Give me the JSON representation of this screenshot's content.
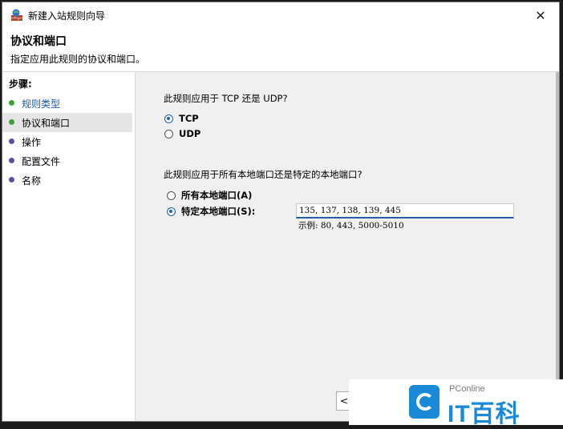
{
  "window": {
    "title": "新建入站规则向导",
    "close_glyph": "✕"
  },
  "header": {
    "title": "协议和端口",
    "subtitle": "指定应用此规则的协议和端口。"
  },
  "sidebar": {
    "steps_title": "步骤:",
    "items": [
      {
        "label": "规则类型",
        "dot_color": "#3aa23a"
      },
      {
        "label": "协议和端口",
        "dot_color": "#3aa23a"
      },
      {
        "label": "操作",
        "dot_color": "#5f4ca8"
      },
      {
        "label": "配置文件",
        "dot_color": "#5f4ca8"
      },
      {
        "label": "名称",
        "dot_color": "#5f4ca8"
      }
    ]
  },
  "main": {
    "protocol_question": "此规则应用于 TCP 还是 UDP?",
    "protocol_options": [
      {
        "label": "TCP",
        "checked": true
      },
      {
        "label": "UDP",
        "checked": false
      }
    ],
    "ports_question": "此规则应用于所有本地端口还是特定的本地端口?",
    "port_options": [
      {
        "label": "所有本地端口(A)",
        "checked": false
      },
      {
        "label": "特定本地端口(S):",
        "checked": true
      }
    ],
    "ports_value": "135, 137, 138, 139, 445",
    "ports_example": "示例: 80, 443, 5000-5010",
    "back_button": "<"
  },
  "watermark": {
    "small": "PConline",
    "big": "IT百科"
  }
}
